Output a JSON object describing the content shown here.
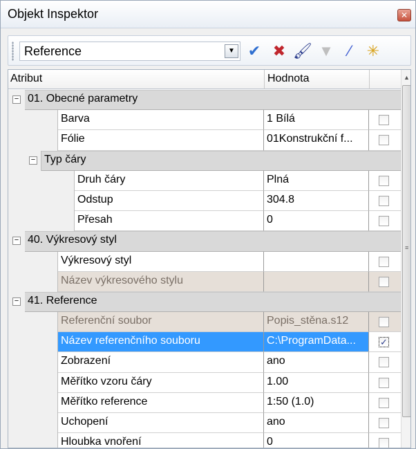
{
  "window": {
    "title": "Objekt Inspektor",
    "close_glyph": "✕"
  },
  "toolbar": {
    "combo_value": "Reference",
    "combo_arrow": "▼",
    "icons": [
      {
        "name": "apply-check-icon",
        "glyph": "✔",
        "color": "#2f6fd0"
      },
      {
        "name": "cancel-cross-icon",
        "glyph": "✖",
        "color": "#c0262d"
      },
      {
        "name": "brush-icon",
        "glyph": "🖌",
        "color": "#2a3b8c"
      },
      {
        "name": "filter-icon",
        "glyph": "▼",
        "color": "#bfbfbf"
      },
      {
        "name": "pick-icon",
        "glyph": "⁄",
        "color": "#3c5ad0"
      },
      {
        "name": "magic-wand-icon",
        "glyph": "✳",
        "color": "#d8a21a"
      }
    ]
  },
  "grid": {
    "header": {
      "attribute": "Atribut",
      "value": "Hodnota"
    },
    "collapse_glyph": "−",
    "check_glyph": "✓",
    "rows": [
      {
        "type": "category",
        "level": 0,
        "label": "01. Obecné parametry"
      },
      {
        "type": "prop",
        "level": 1,
        "name": "Barva",
        "value": "1     Bílá",
        "checked": false
      },
      {
        "type": "prop",
        "level": 1,
        "name": "Fólie",
        "value": "01Konstrukční f...",
        "checked": false
      },
      {
        "type": "category",
        "level": 1,
        "label": "Typ čáry"
      },
      {
        "type": "prop",
        "level": 2,
        "name": "Druh čáry",
        "value": "Plná",
        "checked": false
      },
      {
        "type": "prop",
        "level": 2,
        "name": "Odstup",
        "value": "304.8",
        "checked": false
      },
      {
        "type": "prop",
        "level": 2,
        "name": "Přesah",
        "value": "0",
        "checked": false
      },
      {
        "type": "category",
        "level": 0,
        "label": "40. Výkresový styl"
      },
      {
        "type": "prop",
        "level": 1,
        "name": "Výkresový styl",
        "value": "",
        "checked": false
      },
      {
        "type": "prop",
        "level": 1,
        "name": "Název výkresového stylu",
        "value": "",
        "checked": false,
        "readonly": true
      },
      {
        "type": "category",
        "level": 0,
        "label": "41. Reference"
      },
      {
        "type": "prop",
        "level": 1,
        "name": "Referenční soubor",
        "value": "Popis_stěna.s12",
        "checked": false,
        "readonly": true
      },
      {
        "type": "prop",
        "level": 1,
        "name": "Název referenčního souboru",
        "value": "C:\\ProgramData...",
        "checked": true,
        "selected": true
      },
      {
        "type": "prop",
        "level": 1,
        "name": "Zobrazení",
        "value": "ano",
        "checked": false
      },
      {
        "type": "prop",
        "level": 1,
        "name": "Měřítko vzoru čáry",
        "value": "1.00",
        "checked": false
      },
      {
        "type": "prop",
        "level": 1,
        "name": "Měřítko reference",
        "value": "1:50 (1.0)",
        "checked": false
      },
      {
        "type": "prop",
        "level": 1,
        "name": "Uchopení",
        "value": "ano",
        "checked": false
      },
      {
        "type": "prop",
        "level": 1,
        "name": "Hloubka vnoření",
        "value": "0",
        "checked": false
      }
    ]
  },
  "scrollbar": {
    "up_glyph": "▲",
    "grip_glyph": "≡"
  }
}
